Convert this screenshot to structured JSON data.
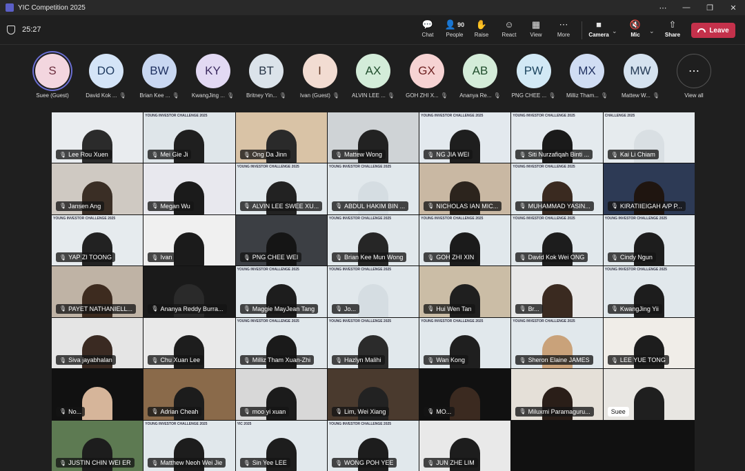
{
  "window": {
    "title": "YIC Competition 2025",
    "controls": [
      "⋯",
      "—",
      "❐",
      "✕"
    ]
  },
  "toolbar": {
    "timer": "25:27",
    "buttons": [
      {
        "label": "Chat",
        "icon": "💬",
        "name": "chat"
      },
      {
        "label": "People",
        "icon": "👤",
        "count": "90",
        "name": "people"
      },
      {
        "label": "Raise",
        "icon": "✋",
        "name": "raise"
      },
      {
        "label": "React",
        "icon": "☺",
        "name": "react"
      },
      {
        "label": "View",
        "icon": "▦",
        "name": "view"
      },
      {
        "label": "More",
        "icon": "⋯",
        "name": "more"
      },
      {
        "label": "Camera",
        "icon": "■",
        "name": "camera"
      },
      {
        "label": "Mic",
        "icon": "🔇",
        "name": "mic"
      },
      {
        "label": "Share",
        "icon": "⇧",
        "name": "share"
      }
    ],
    "leave_label": "Leave",
    "leave_color": "#c4314b"
  },
  "avatars": [
    {
      "initials": "S",
      "name": "Suee (Guest)",
      "bg": "#f3d6df",
      "fg": "#6b2d3d"
    },
    {
      "initials": "DO",
      "name": "David Kok ...",
      "bg": "#d4e4f7",
      "fg": "#1e3a5f"
    },
    {
      "initials": "BW",
      "name": "Brian Kee ...",
      "bg": "#c9d7f1",
      "fg": "#1e2f5f"
    },
    {
      "initials": "KY",
      "name": "KwangJing ...",
      "bg": "#e2d9f3",
      "fg": "#3b2a5f"
    },
    {
      "initials": "BT",
      "name": "Britney Yin...",
      "bg": "#dbe3ea",
      "fg": "#263445"
    },
    {
      "initials": "I",
      "name": "Ivan (Guest)",
      "bg": "#f2dcd2",
      "fg": "#5f3422"
    },
    {
      "initials": "AX",
      "name": "ALVIN LEE ...",
      "bg": "#d3ecd9",
      "fg": "#1f4d2c"
    },
    {
      "initials": "GX",
      "name": "GOH ZHI X...",
      "bg": "#f6d3d3",
      "fg": "#6b1f1f"
    },
    {
      "initials": "AB",
      "name": "Ananya Re...",
      "bg": "#d4ecd9",
      "fg": "#1f4d2c"
    },
    {
      "initials": "PW",
      "name": "PNG CHEE ...",
      "bg": "#d2e9f5",
      "fg": "#1d4660"
    },
    {
      "initials": "MX",
      "name": "Milliz Tham...",
      "bg": "#d0ddf3",
      "fg": "#1e2f5f"
    },
    {
      "initials": "MW",
      "name": "Mattew W...",
      "bg": "#d5e2ef",
      "fg": "#243a55"
    }
  ],
  "view_all": {
    "icon": "⋯",
    "label": "View all"
  },
  "tiles": [
    {
      "name": "Lee Rou Xuen",
      "bg": "#e9ecef",
      "skin": "#2b2b2b"
    },
    {
      "name": "Mei Gie Ji",
      "bg": "#dfe6ea",
      "skin": "#1f1f1f",
      "banner": "YOUNG INVESTOR CHALLENGE 2025"
    },
    {
      "name": "Ong Da Jinn",
      "bg": "#d9c3a6",
      "skin": "#2a2a2a"
    },
    {
      "name": "Mattew Wong",
      "bg": "#cfd3d6",
      "skin": "#222"
    },
    {
      "name": "NG JIA WEI",
      "bg": "#e3e9ee",
      "skin": "#1e1e1e",
      "banner": "YOUNG INVESTOR CHALLENGE 2025"
    },
    {
      "name": "Siti Nurzafiqah Binti ...",
      "bg": "#e4eaee",
      "skin": "#1a1a1a",
      "banner": "YOUNG INVESTOR CHALLENGE 2025"
    },
    {
      "name": "Kai Li Chiam",
      "bg": "#e6ebee",
      "skin": "#d9dfe3",
      "banner": "CHALLENGE 2025"
    },
    {
      "name": "Jansen Ang",
      "bg": "#cfc9c2",
      "skin": "#3a2e25"
    },
    {
      "name": "Megan Wu",
      "bg": "#e8e8ee",
      "skin": "#1b1b1b"
    },
    {
      "name": "ALVIN LEE SWEE XU...",
      "bg": "#e1e8ec",
      "skin": "#222",
      "banner": "YOUNG INVESTOR CHALLENGE 2025"
    },
    {
      "name": "ABDUL HAKIM BIN ...",
      "bg": "#e1e8ec",
      "skin": "#d5dde2",
      "banner": "YOUNG INVESTOR CHALLENGE 2025"
    },
    {
      "name": "NICHOLAS IAN MIC...",
      "bg": "#c9b8a3",
      "skin": "#2c241d"
    },
    {
      "name": "MUHAMMAD YASIN...",
      "bg": "#e1e8ec",
      "skin": "#3a2a20",
      "banner": "YOUNG INVESTOR CHALLENGE 2025"
    },
    {
      "name": "KIRATIIEIGAH A/P P...",
      "bg": "#2d3a55",
      "skin": "#1f1510"
    },
    {
      "name": "YAP ZI TOONG",
      "bg": "#e6ebee",
      "skin": "#222",
      "banner": "YOUNG INVESTOR CHALLENGE 2025"
    },
    {
      "name": "Ivan",
      "bg": "#f0f0f0",
      "skin": "#1b1b1b"
    },
    {
      "name": "PNG CHEE WEI",
      "bg": "#3c3f44",
      "skin": "#151515"
    },
    {
      "name": "Brian Kee Mun Wong",
      "bg": "#e1e8ec",
      "skin": "#262626",
      "banner": "YOUNG INVESTOR CHALLENGE 2025"
    },
    {
      "name": "GOH ZHI XIN",
      "bg": "#e1e8ec",
      "skin": "#1b1b1b",
      "banner": "YOUNG INVESTOR CHALLENGE 2025"
    },
    {
      "name": "David Kok Wei ONG",
      "bg": "#e1e8ec",
      "skin": "#1d1d1d",
      "banner": "YOUNG INVESTOR CHALLENGE 2025"
    },
    {
      "name": "Cindy Ngun",
      "bg": "#e1e8ec",
      "skin": "#1d1d1d",
      "banner": "YOUNG INVESTOR CHALLENGE 2025"
    },
    {
      "name": "PAYET NATHANIELL...",
      "bg": "#bfb3a5",
      "skin": "#3d2b1f"
    },
    {
      "name": "Ananya Reddy Burra...",
      "bg": "#1a1a1a",
      "skin": "#2a2a2a"
    },
    {
      "name": "Maggie MayJean Tang",
      "bg": "#e1e8ec",
      "skin": "#1d1d1d",
      "banner": "YOUNG INVESTOR CHALLENGE 2025"
    },
    {
      "name": "Jo...",
      "bg": "#e1e8ec",
      "skin": "#d5dde2",
      "banner": "YOUNG INVESTOR CHALLENGE 2025"
    },
    {
      "name": "Hui Wen Tan",
      "bg": "#cbbda6",
      "skin": "#1f1f1f"
    },
    {
      "name": "Br...",
      "bg": "#e8e8e8",
      "skin": "#3a2a20"
    },
    {
      "name": "KwangJing Yii",
      "bg": "#e1e8ec",
      "skin": "#1d1d1d",
      "banner": "YOUNG INVESTOR CHALLENGE 2025"
    },
    {
      "name": "Siva jayabhalan",
      "bg": "#e5e5e5",
      "skin": "#3a2a22"
    },
    {
      "name": "Chu Xuan Lee",
      "bg": "#e9e9e9",
      "skin": "#1d1d1d"
    },
    {
      "name": "Milliz Tham Xuan-Zhi",
      "bg": "#e1e8ec",
      "skin": "#1a1a1a",
      "banner": "YOUNG INVESTOR CHALLENGE 2025"
    },
    {
      "name": "Hazlyn Malihi",
      "bg": "#e1e8ec",
      "skin": "#2b2b2b",
      "banner": "YOUNG INVESTOR CHALLENGE 2025"
    },
    {
      "name": "Wan Kong",
      "bg": "#e1e8ec",
      "skin": "#1f1f1f",
      "banner": "YOUNG INVESTOR CHALLENGE 2025"
    },
    {
      "name": "Sheron Elaine JAMES",
      "bg": "#e1e8ec",
      "skin": "#c9a27a",
      "banner": "YOUNG INVESTOR CHALLENGE 2025"
    },
    {
      "name": "LEE YUE TONG",
      "bg": "#f0ede8",
      "skin": "#1d1d1d"
    },
    {
      "name": "No...",
      "bg": "#111",
      "skin": "#d6b59a"
    },
    {
      "name": "Adrian Cheah",
      "bg": "#8a6a4a",
      "skin": "#1c1c1c"
    },
    {
      "name": "moo yi xuan",
      "bg": "#d8d8d8",
      "skin": "#1b1b1b"
    },
    {
      "name": "Lim, Wei Xiang",
      "bg": "#4a3a2e",
      "skin": "#222"
    },
    {
      "name": "MO...",
      "bg": "#111",
      "skin": "#3b2a20"
    },
    {
      "name": "Miluxmi Paramaguru...",
      "bg": "#e5e0d8",
      "skin": "#2a1e18"
    },
    {
      "name": "Suee",
      "bg": "#e8e6e2",
      "skin": "#1f1f1f",
      "light": true
    },
    {
      "name": "JUSTIN CHIN WEI ER",
      "bg": "#5d7a52",
      "skin": "#1d1d1d"
    },
    {
      "name": "Matthew Neoh Wei Jie",
      "bg": "#e1e8ec",
      "skin": "#1d1d1d",
      "banner": "YOUNG INVESTOR CHALLENGE 2025"
    },
    {
      "name": "Sin Yee LEE",
      "bg": "#e1e8ec",
      "skin": "#1d1d1d",
      "banner": "YIC 2025"
    },
    {
      "name": "WONG POH YEE",
      "bg": "#e1e8ec",
      "skin": "#1d1d1d",
      "banner": "YOUNG INVESTOR CHALLENGE 2025"
    },
    {
      "name": "JUN ZHE LIM",
      "bg": "#e9e9e9",
      "skin": "#1d1d1d"
    }
  ]
}
